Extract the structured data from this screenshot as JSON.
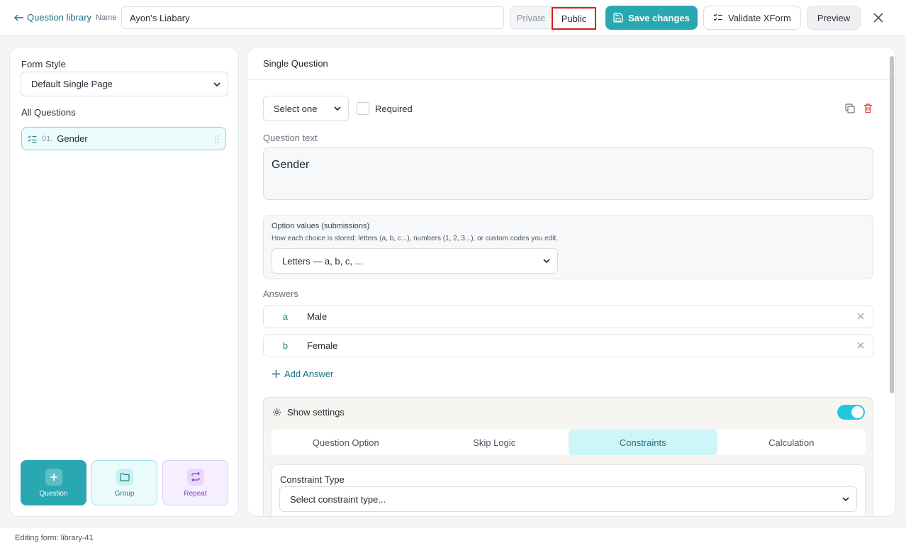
{
  "header": {
    "back_label": "Question library",
    "name_label": "Name",
    "name_value": "Ayon's Liabary",
    "visibility": {
      "private": "Private",
      "public": "Public"
    },
    "save_label": "Save changes",
    "validate_label": "Validate XForm",
    "preview_label": "Preview"
  },
  "sidebar": {
    "form_style_label": "Form Style",
    "form_style_value": "Default Single Page",
    "all_questions_label": "All Questions",
    "questions": [
      {
        "number": "01.",
        "label": "Gender"
      }
    ],
    "add_buttons": {
      "question": "Question",
      "group": "Group",
      "repeat": "Repeat"
    }
  },
  "editor": {
    "header_title": "Single Question",
    "type_value": "Select one",
    "required_label": "Required",
    "question_text_label": "Question text",
    "question_text_value": "Gender",
    "option_values": {
      "title": "Option values (submissions)",
      "description": "How each choice is stored: letters (a, b, c...), numbers (1, 2, 3...), or custom codes you edit.",
      "value": "Letters — a, b, c, ..."
    },
    "answers_label": "Answers",
    "answers": [
      {
        "code": "a",
        "label": "Male"
      },
      {
        "code": "b",
        "label": "Female"
      }
    ],
    "add_answer_label": "Add Answer",
    "settings": {
      "label": "Show settings",
      "enabled": true,
      "tabs": [
        "Question Option",
        "Skip Logic",
        "Constraints",
        "Calculation"
      ],
      "active_tab": "Constraints",
      "constraint_type_label": "Constraint Type",
      "constraint_type_placeholder": "Select constraint type..."
    }
  },
  "footer": {
    "status": "Editing form: library-41"
  },
  "colors": {
    "accent": "#2aa8b1",
    "highlight": "#e0191b",
    "danger": "#e53935",
    "repeat": "#7a3fc2"
  }
}
